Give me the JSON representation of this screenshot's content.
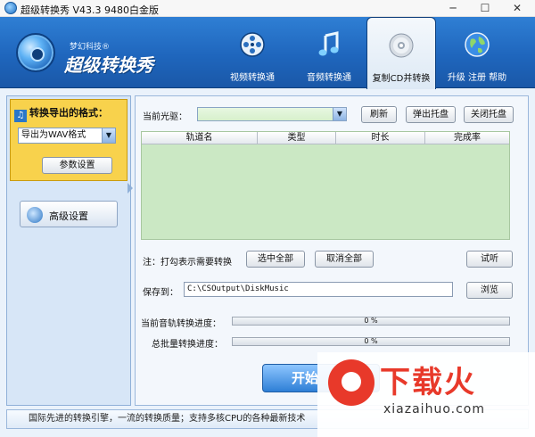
{
  "window": {
    "title": "超级转换秀  V43.3  9480白金版",
    "minimize_glyph": "─",
    "maximize_glyph": "☐",
    "close_glyph": "✕"
  },
  "header": {
    "company": "梦幻科技®",
    "app_name": "超级转换秀",
    "nav": [
      {
        "label": "视频转换通",
        "icon": "film-reel-icon"
      },
      {
        "label": "音频转换通",
        "icon": "music-note-icon"
      },
      {
        "label": "复制CD并转换",
        "icon": "cd-disc-icon",
        "active": true
      },
      {
        "label": "升级 注册 帮助",
        "icon": "globe-icon"
      }
    ]
  },
  "left_panel": {
    "format_header": "转换导出的格式：",
    "format_selected": "导出为WAV格式",
    "params_button": "参数设置",
    "advanced_button": "高级设置"
  },
  "main": {
    "drive_label": "当前光驱：",
    "drive_value": "",
    "refresh_button": "刷新",
    "eject_button": "弹出托盘",
    "close_tray_button": "关闭托盘",
    "table": {
      "columns": [
        "轨道名",
        "类型",
        "时长",
        "完成率"
      ],
      "rows": []
    },
    "note": "注：打勾表示需要转换",
    "select_all_button": "选中全部",
    "deselect_all_button": "取消全部",
    "listen_button": "试听",
    "save_label": "保存到：",
    "save_path": "C:\\CSOutput\\DiskMusic",
    "browse_button": "浏览",
    "track_progress_label": "当前音轨转换进度：",
    "track_progress_text": "0 %",
    "batch_progress_label": "总批量转换进度：",
    "batch_progress_text": "0 %",
    "start_button": "开始"
  },
  "status_bar": {
    "text": "国际先进的转换引擎，一流的转换质量；支持多核CPU的各种最新技术"
  },
  "watermark": {
    "brand": "下载火",
    "url": "xiazaihuo.com"
  }
}
